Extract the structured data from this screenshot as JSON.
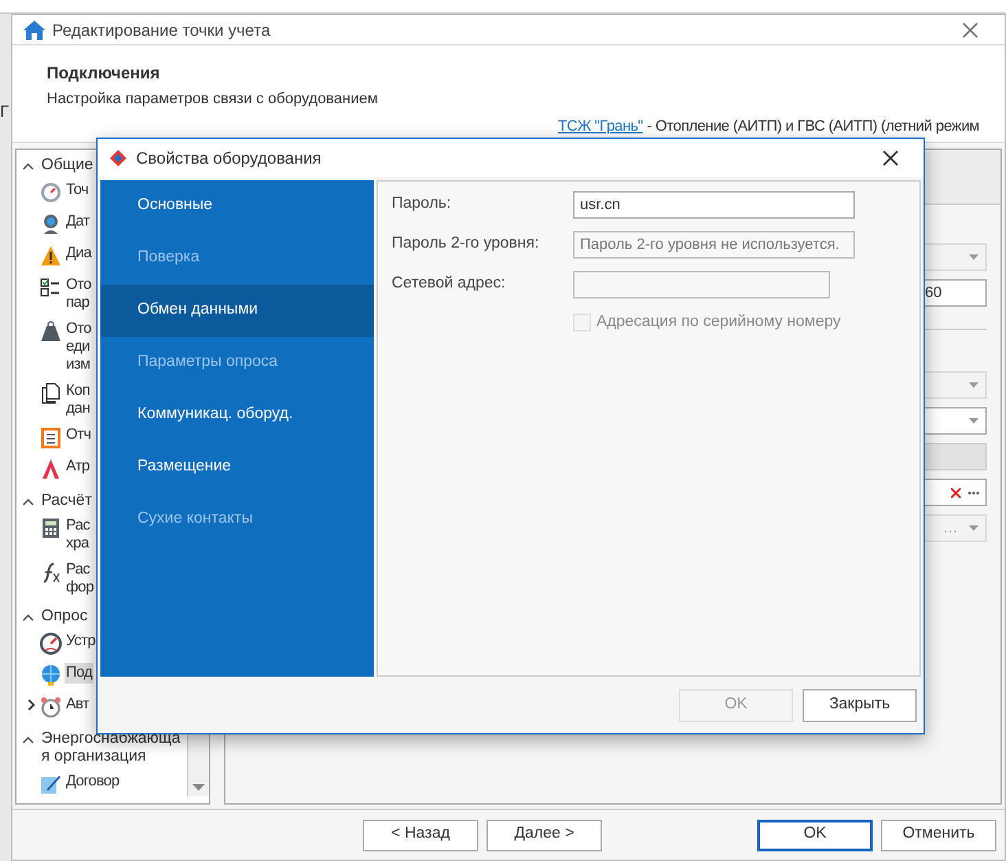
{
  "background_app": {
    "text": "Г"
  },
  "window": {
    "title": "Редактирование точки учета"
  },
  "header": {
    "title": "Подключения",
    "subtitle": "Настройка параметров связи с оборудованием",
    "link": "ТСЖ \"Грань\"",
    "context": "- Отопление (АИТП) и ГВС (АИТП) (летний режим"
  },
  "sidebar": {
    "sections": [
      {
        "label": "Общие",
        "expanded": true,
        "items": [
          {
            "kind": "gauge",
            "lines": [
              "Точ"
            ],
            "selected": false
          },
          {
            "kind": "webcam",
            "lines": [
              "Дат"
            ],
            "selected": false
          },
          {
            "kind": "warning",
            "lines": [
              "Диа"
            ],
            "selected": false
          },
          {
            "kind": "checklist",
            "lines": [
              "Ото",
              "пар"
            ],
            "selected": false
          },
          {
            "kind": "weight",
            "lines": [
              "Ото",
              "еди",
              "изм"
            ],
            "selected": false
          },
          {
            "kind": "copy",
            "lines": [
              "Коп",
              "дан"
            ],
            "selected": false
          },
          {
            "kind": "clipboard",
            "lines": [
              "Отч"
            ],
            "selected": false
          },
          {
            "kind": "peak",
            "lines": [
              "Атр"
            ],
            "selected": false
          }
        ]
      },
      {
        "label": "Расчёт",
        "expanded": true,
        "items": [
          {
            "kind": "calculator",
            "lines": [
              "Рас",
              "хра"
            ],
            "selected": false
          },
          {
            "kind": "function",
            "lines": [
              "Рас",
              "фор"
            ],
            "selected": false
          }
        ]
      },
      {
        "label": "Опрос",
        "expanded": true,
        "items": [
          {
            "kind": "speedometer",
            "lines": [
              "Устр"
            ],
            "selected": false
          },
          {
            "kind": "globe",
            "lines": [
              "Под"
            ],
            "selected": true
          },
          {
            "kind": "alarm",
            "lines": [
              "Авт"
            ],
            "selected": false,
            "expanded": false
          }
        ]
      },
      {
        "label": "Энергоснабжающа я организация",
        "expanded": true,
        "items": [
          {
            "kind": "pen",
            "lines": [
              "Договор"
            ],
            "selected": false
          }
        ]
      }
    ]
  },
  "right_panel": {
    "fields": [
      {
        "kind": "dropdown",
        "disabled": true
      },
      {
        "kind": "text",
        "value": "60"
      },
      {
        "kind": "dropdown",
        "disabled": true
      },
      {
        "kind": "dropdown",
        "disabled": false
      },
      {
        "kind": "group_header"
      },
      {
        "kind": "picker"
      },
      {
        "kind": "dropdown",
        "disabled": true,
        "value": "…"
      }
    ]
  },
  "dialog": {
    "title": "Свойства оборудования",
    "nav": [
      {
        "label": "Основные",
        "selected": false,
        "disabled": false
      },
      {
        "label": "Поверка",
        "selected": false,
        "disabled": true
      },
      {
        "label": "Обмен данными",
        "selected": true,
        "disabled": false
      },
      {
        "label": "Параметры опроса",
        "selected": false,
        "disabled": true
      },
      {
        "label": "Коммуникац. оборуд.",
        "selected": false,
        "disabled": false
      },
      {
        "label": "Размещение",
        "selected": false,
        "disabled": false
      },
      {
        "label": "Сухие контакты",
        "selected": false,
        "disabled": true
      }
    ],
    "fields": [
      {
        "kind": "input",
        "label": "Пароль:",
        "value": "usr.cn",
        "disabled": false
      },
      {
        "kind": "input",
        "label": "Пароль 2-го уровня:",
        "placeholder": "Пароль 2-го уровня не используется.",
        "disabled": true
      },
      {
        "kind": "input",
        "label": "Сетевой адрес:",
        "disabled": true
      },
      {
        "kind": "checkbox",
        "label": "Адресация по серийному номеру",
        "checked": false,
        "disabled": true
      }
    ],
    "buttons": [
      {
        "label": "OK",
        "disabled": true
      },
      {
        "label": "Закрыть",
        "disabled": false
      }
    ]
  },
  "footer_buttons": [
    {
      "label": "< Назад",
      "default": false
    },
    {
      "label": "Далее >",
      "default": false
    },
    {
      "label": "OK",
      "default": true
    },
    {
      "label": "Отменить",
      "default": false
    }
  ]
}
